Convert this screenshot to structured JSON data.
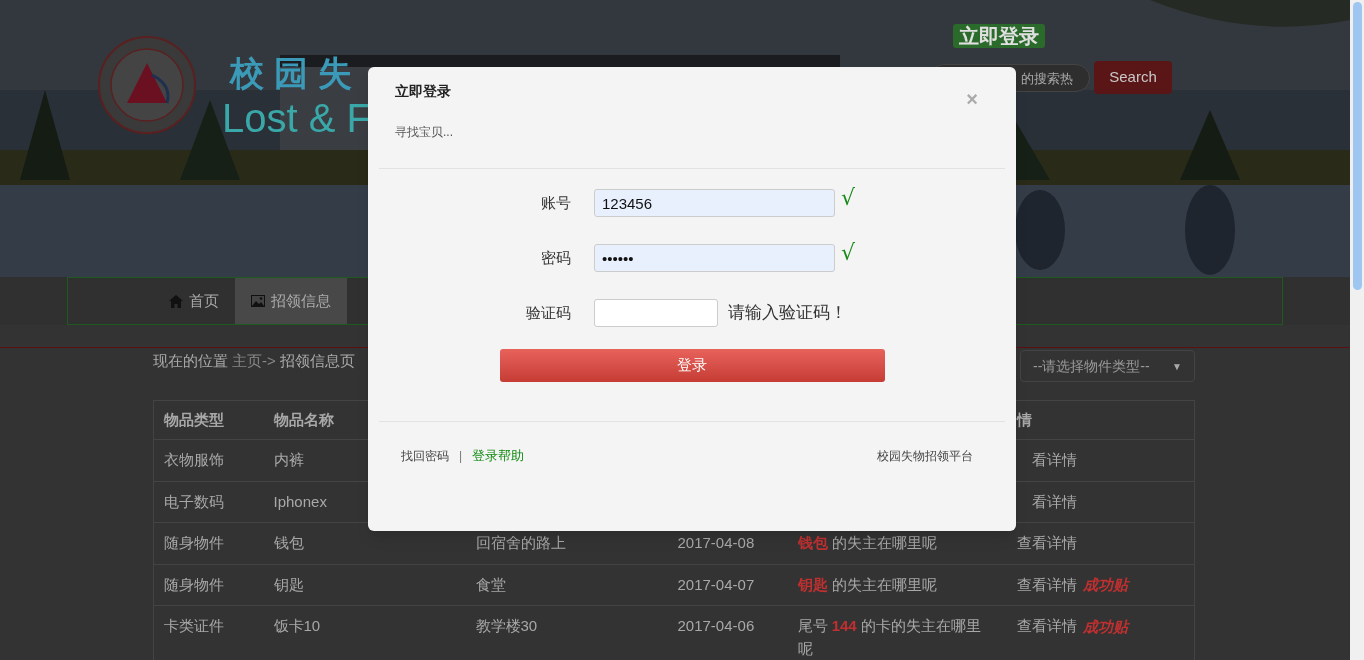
{
  "header": {
    "title_cn": "校园失",
    "title_en": "Lost & F",
    "login_badge": "立即登录",
    "search": {
      "placeholder": "的搜索热"
    },
    "search_button": "Search"
  },
  "nav": [
    {
      "label": "首页",
      "selected": false
    },
    {
      "label": "招领信息",
      "selected": true
    }
  ],
  "breadcrumb": {
    "label": "现在的位置",
    "home_link": "主页->",
    "current": "招领信息页"
  },
  "type_select": {
    "placeholder": "--请选择物件类型--",
    "caret": "▼"
  },
  "table": {
    "columns": [
      "物品类型",
      "物品名称",
      "",
      "",
      "",
      "情"
    ],
    "rows": [
      {
        "type": "衣物服饰",
        "name": "内裤",
        "details": "看详情"
      },
      {
        "type": "电子数码",
        "name": "Iphonex",
        "details": "看详情"
      },
      {
        "type": "随身物件",
        "name": "钱包",
        "location": "回宿舍的路上",
        "date": "2017-04-08",
        "description": "**钱包** 的失主在哪里呢",
        "details": "查看详情"
      },
      {
        "type": "随身物件",
        "name": "钥匙",
        "location": "食堂",
        "date": "2017-04-07",
        "description": "**钥匙** 的失主在哪里呢",
        "details": "查看详情",
        "tag": "成功贴"
      },
      {
        "type": "卡类证件",
        "name": "饭卡10",
        "location": "教学楼30",
        "date": "2017-04-06",
        "description": "尾号 **144** 的卡的失主在哪里呢",
        "details": "查看详情",
        "tag": "成功贴"
      }
    ]
  },
  "modal": {
    "title": "立即登录",
    "subtitle": "寻找宝贝...",
    "close": "×",
    "fields": [
      {
        "label": "账号",
        "value": "123456",
        "kind": "text",
        "autofilled": true,
        "valid": true,
        "valid_mark": "√"
      },
      {
        "label": "密码",
        "value": "••••••",
        "kind": "password",
        "autofilled": true,
        "valid": true,
        "valid_mark": "√"
      },
      {
        "label": "验证码",
        "kind": "captcha",
        "autofilled": false,
        "valid": false,
        "message": "请输入验证码！"
      }
    ],
    "submit": "登录",
    "footer": {
      "links": [
        {
          "label": "找回密码",
          "highlight": false
        },
        {
          "label": "登录帮助",
          "highlight": true
        }
      ],
      "separator": "|",
      "brand": "校园失物招领平台"
    }
  }
}
